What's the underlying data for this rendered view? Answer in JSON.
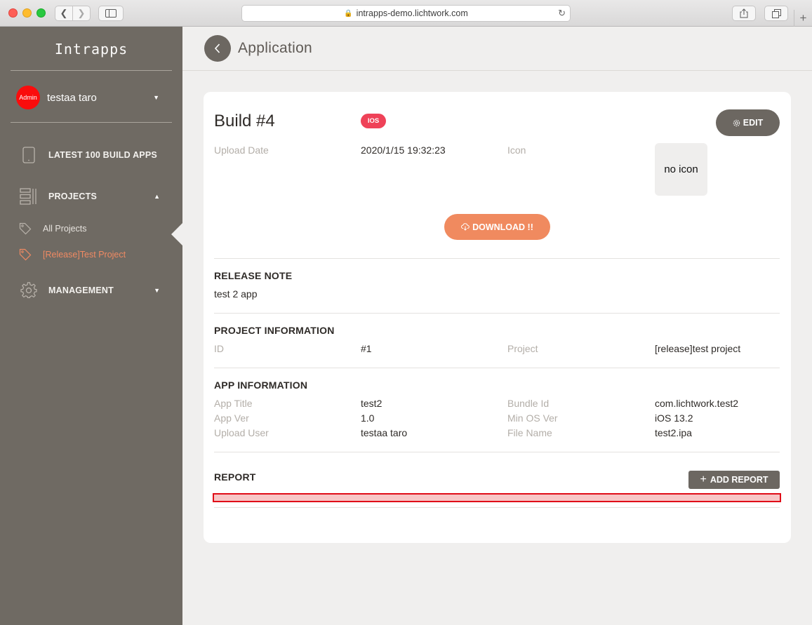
{
  "browser": {
    "url": "intrapps-demo.lichtwork.com"
  },
  "sidebar": {
    "brand": "Intrapps",
    "user": {
      "avatar_label": "Admin",
      "name": "testaa taro"
    },
    "nav": {
      "latest": "LATEST 100 BUILD APPS",
      "projects": "PROJECTS",
      "management": "MANAGEMENT"
    },
    "projects_sub": {
      "all": "All Projects",
      "release": "[Release]Test Project"
    }
  },
  "header": {
    "title": "Application"
  },
  "build": {
    "title": "Build #4",
    "platform_badge": "IOS",
    "edit_label": "EDIT",
    "upload_date_label": "Upload Date",
    "upload_date_value": "2020/1/15 19:32:23",
    "icon_label": "Icon",
    "icon_placeholder": "no icon",
    "download_label": "DOWNLOAD !!"
  },
  "release_note": {
    "title": "RELEASE NOTE",
    "text": "test 2 app"
  },
  "project_info": {
    "title": "PROJECT INFORMATION",
    "id_label": "ID",
    "id_value": "#1",
    "project_label": "Project",
    "project_value": "[release]test project"
  },
  "app_info": {
    "title": "APP INFORMATION",
    "app_title_label": "App Title",
    "app_title_value": "test2",
    "bundle_id_label": "Bundle Id",
    "bundle_id_value": "com.lichtwork.test2",
    "app_ver_label": "App Ver",
    "app_ver_value": "1.0",
    "min_os_label": "Min OS Ver",
    "min_os_value": "iOS 13.2",
    "upload_user_label": "Upload User",
    "upload_user_value": "testaa taro",
    "file_name_label": "File Name",
    "file_name_value": "test2.ipa"
  },
  "report": {
    "title": "REPORT",
    "add_label": "ADD REPORT"
  },
  "colors": {
    "sidebar_bg": "#6f6a63",
    "accent_orange": "#f08a5f",
    "ios_badge": "#ef4258",
    "highlight_border": "#e00d18"
  }
}
